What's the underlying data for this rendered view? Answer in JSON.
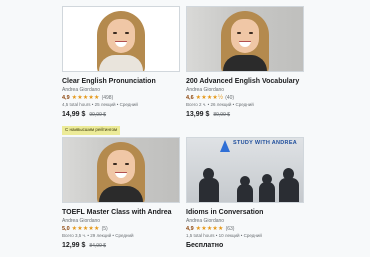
{
  "courses": [
    {
      "title": "Clear English Pronunciation",
      "author": "Andrea Giordano",
      "rating": "4,9",
      "stars": "★★★★★",
      "reviews": "(498)",
      "meta": "4,5 total hours • 25 лекций • Средний",
      "price": "14,99 $",
      "old_price": "99,99 $",
      "badge": "С наивысшим рейтингом"
    },
    {
      "title": "200 Advanced English Vocabulary",
      "author": "Andrea Giordano",
      "rating": "4,6",
      "stars": "★★★★½",
      "reviews": "(40)",
      "meta": "Всего 2 ч. • 26 лекций • Средний",
      "price": "13,99 $",
      "old_price": "89,99 $"
    },
    {
      "title": "TOEFL Master Class with Andrea",
      "author": "Andrea Giordano",
      "rating": "5,0",
      "stars": "★★★★★",
      "reviews": "(5)",
      "meta": "Всего 3,5 ч. • 29 лекций • Средний",
      "price": "12,99 $",
      "old_price": "84,99 $"
    },
    {
      "title": "Idioms in Conversation",
      "author": "Andrea Giordano",
      "rating": "4,9",
      "stars": "★★★★★",
      "reviews": "(63)",
      "meta": "1,5 total hours • 10 лекций • Средний",
      "price": "Бесплатно",
      "thumb_text": "STUDY WITH ANDREA"
    }
  ]
}
